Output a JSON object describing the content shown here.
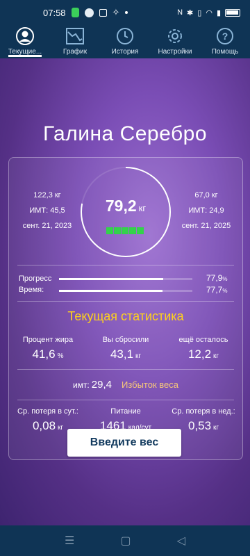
{
  "status_bar": {
    "time": "07:58",
    "battery_icon": "battery-icon",
    "wifi_icon": "wifi-icon"
  },
  "tabs": [
    {
      "label": "Текущие...",
      "icon": "profile-icon",
      "active": true
    },
    {
      "label": "График",
      "icon": "chart-icon",
      "active": false
    },
    {
      "label": "История",
      "icon": "clock-icon",
      "active": false
    },
    {
      "label": "Настройки",
      "icon": "gear-icon",
      "active": false
    },
    {
      "label": "Помощь",
      "icon": "help-icon",
      "active": false
    }
  ],
  "user": {
    "name": "Галина Серебро"
  },
  "weight": {
    "current_value": "79,2",
    "unit": "кг",
    "start": {
      "weight": "122,3 кг",
      "bmi": "ИМТ: 45,5",
      "date": "сент. 21, 2023"
    },
    "goal": {
      "weight": "67,0 кг",
      "bmi": "ИМТ: 24,9",
      "date": "сент. 21, 2025"
    },
    "ring_progress": 0.78,
    "level_bars": 5
  },
  "progress": [
    {
      "label": "Прогресс",
      "value": "77,9",
      "unit": "%",
      "fraction": 0.779
    },
    {
      "label": "Время:",
      "value": "77,7",
      "unit": "%",
      "fraction": 0.777
    }
  ],
  "current_stats": {
    "title": "Текущая статистика",
    "row1": [
      {
        "label": "Процент жира",
        "value": "41,6",
        "unit": "%"
      },
      {
        "label": "Вы сбросили",
        "value": "43,1",
        "unit": "кг"
      },
      {
        "label": "ещё осталось",
        "value": "12,2",
        "unit": "кг"
      }
    ],
    "bmi_label": "имт:",
    "bmi_value": "29,4",
    "bmi_category": "Избыток веса",
    "row2": [
      {
        "label": "Ср. потеря в сут.:",
        "value": "0,08",
        "unit": "кг"
      },
      {
        "label": "Питание",
        "value": "1461",
        "unit": "кал/сут"
      },
      {
        "label": "Ср. потеря в нед.:",
        "value": "0,53",
        "unit": "кг"
      }
    ]
  },
  "actions": {
    "enter_weight": "Введите вес"
  },
  "colors": {
    "accent_yellow": "#ffd21a",
    "bar_green": "#33d24b",
    "header_bg": "#0f3455"
  }
}
